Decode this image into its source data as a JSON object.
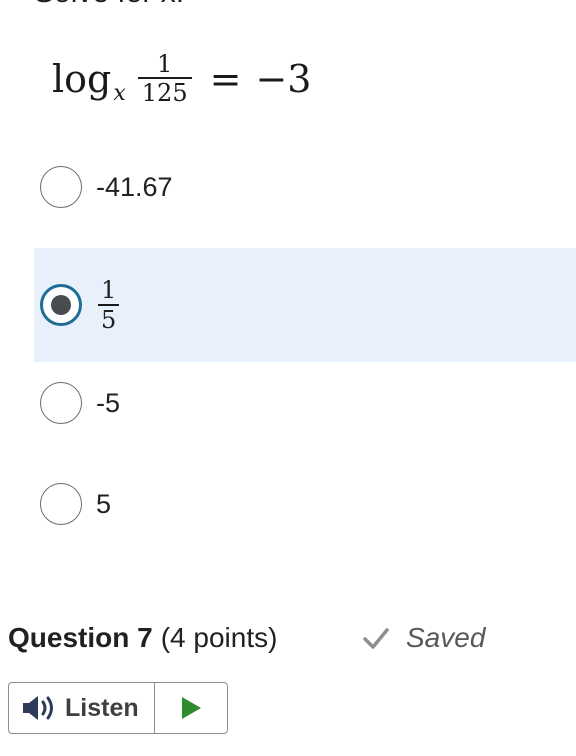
{
  "question": {
    "prompt": "Solve for x.",
    "equation": {
      "log": "log",
      "base": "x",
      "numerator": "1",
      "denominator": "125",
      "equals": "=",
      "rhs": "−3"
    }
  },
  "options": [
    {
      "label": "-41.67",
      "selected": false
    },
    {
      "numerator": "1",
      "denominator": "5",
      "selected": true
    },
    {
      "label": "-5",
      "selected": false
    },
    {
      "label": "5",
      "selected": false
    }
  ],
  "next_question": {
    "title": "Question 7",
    "points": "(4 points)",
    "status": "Saved"
  },
  "listen": {
    "label": "Listen"
  },
  "colors": {
    "selected_bg": "#e8f1fb",
    "radio_checked_border": "#1f6d94",
    "play_green": "#2e8b2e",
    "speaker": "#2f3b5a"
  },
  "icons": [
    "check-icon",
    "speaker-icon",
    "play-icon"
  ]
}
